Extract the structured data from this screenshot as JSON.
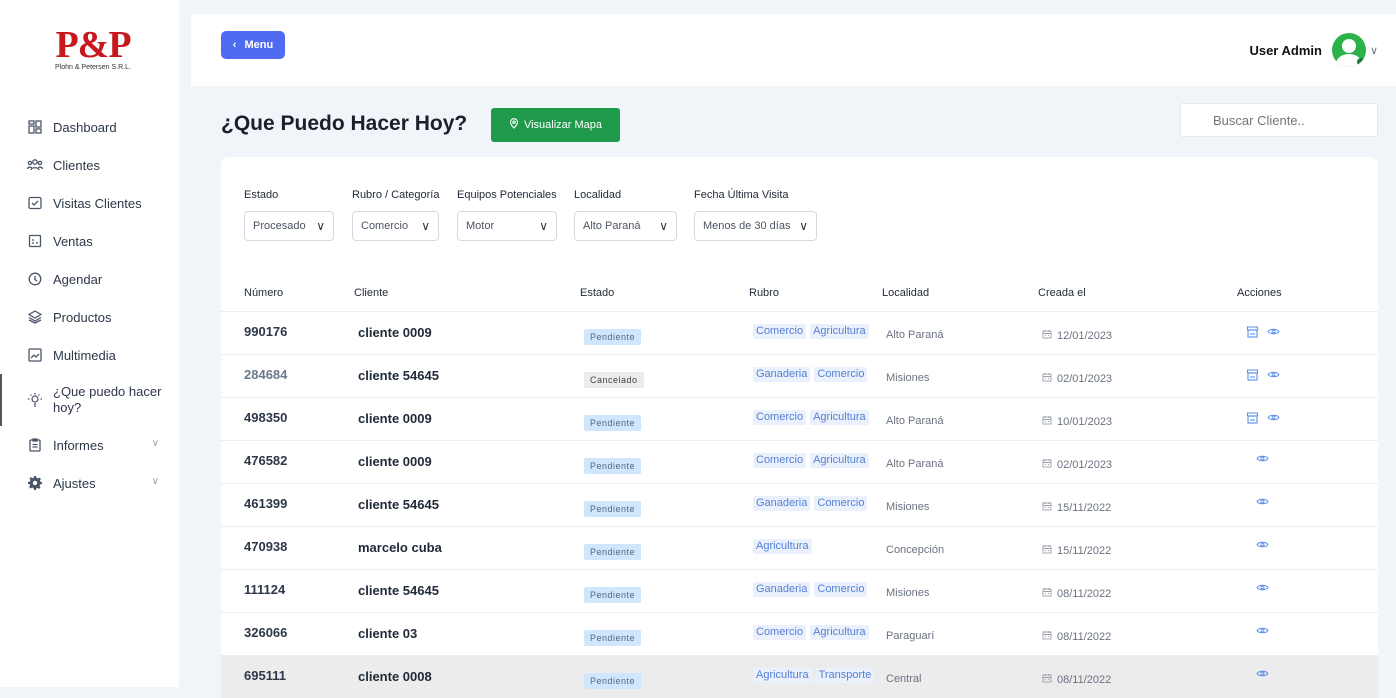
{
  "brand": {
    "logo_text": "P&P",
    "logo_sub": "Plohn & Petersen S.R.L."
  },
  "sidebar": {
    "items": [
      {
        "label": "Dashboard",
        "icon": "dashboard-icon"
      },
      {
        "label": "Clientes",
        "icon": "users-icon"
      },
      {
        "label": "Visitas Clientes",
        "icon": "checklist-icon"
      },
      {
        "label": "Ventas",
        "icon": "invoice-icon"
      },
      {
        "label": "Agendar",
        "icon": "clock-icon"
      },
      {
        "label": "Productos",
        "icon": "layers-icon"
      },
      {
        "label": "Multimedia",
        "icon": "image-icon"
      },
      {
        "label": "¿Que puedo hacer hoy?",
        "icon": "lightbulb-icon"
      },
      {
        "label": "Informes",
        "icon": "clipboard-icon"
      },
      {
        "label": "Ajustes",
        "icon": "gear-icon"
      }
    ]
  },
  "topbar": {
    "menu_label": "Menu",
    "user_name": "User Admin"
  },
  "page": {
    "title": "¿Que Puedo Hacer Hoy?",
    "map_button": "Visualizar Mapa",
    "search_placeholder": "Buscar Cliente.."
  },
  "filters": [
    {
      "label": "Estado",
      "value": "Procesado"
    },
    {
      "label": "Rubro / Categoría",
      "value": "Comercio"
    },
    {
      "label": "Equipos Potenciales",
      "value": "Motor"
    },
    {
      "label": "Localidad",
      "value": "Alto Paraná"
    },
    {
      "label": "Fecha Última Visita",
      "value": "Menos de 30 días"
    }
  ],
  "table": {
    "headers": [
      "Número",
      "Cliente",
      "Estado",
      "Rubro",
      "Localidad",
      "Creada el",
      "Acciones"
    ],
    "rows": [
      {
        "numero": "990176",
        "cliente": "cliente 0009",
        "estado": "Pendiente",
        "rubro": [
          "Comercio",
          "Agricultura"
        ],
        "localidad": "Alto Paraná",
        "fecha": "12/01/2023"
      },
      {
        "numero": "284684",
        "cliente": "cliente 54645",
        "estado": "Cancelado",
        "rubro": [
          "Ganaderia",
          "Comercio"
        ],
        "localidad": "Misiones",
        "fecha": "02/01/2023"
      },
      {
        "numero": "498350",
        "cliente": "cliente 0009",
        "estado": "Pendiente",
        "rubro": [
          "Comercio",
          "Agricultura"
        ],
        "localidad": "Alto Paraná",
        "fecha": "10/01/2023"
      },
      {
        "numero": "476582",
        "cliente": "cliente 0009",
        "estado": "Pendiente",
        "rubro": [
          "Comercio",
          "Agricultura"
        ],
        "localidad": "Alto Paraná",
        "fecha": "02/01/2023"
      },
      {
        "numero": "461399",
        "cliente": "cliente 54645",
        "estado": "Pendiente",
        "rubro": [
          "Ganaderia",
          "Comercio"
        ],
        "localidad": "Misiones",
        "fecha": "15/11/2022"
      },
      {
        "numero": "470938",
        "cliente": "marcelo cuba",
        "estado": "Pendiente",
        "rubro": [
          "Agricultura"
        ],
        "localidad": "Concepción",
        "fecha": "15/11/2022"
      },
      {
        "numero": "111124",
        "cliente": "cliente 54645",
        "estado": "Pendiente",
        "rubro": [
          "Ganaderia",
          "Comercio"
        ],
        "localidad": "Misiones",
        "fecha": "08/11/2022"
      },
      {
        "numero": "326066",
        "cliente": "cliente 03",
        "estado": "Pendiente",
        "rubro": [
          "Comercio",
          "Agricultura"
        ],
        "localidad": "Paraguarí",
        "fecha": "08/11/2022"
      },
      {
        "numero": "695111",
        "cliente": "cliente 0008",
        "estado": "Pendiente",
        "rubro": [
          "Agricultura",
          "Transporte"
        ],
        "localidad": "Central",
        "fecha": "08/11/2022"
      }
    ]
  },
  "colors": {
    "accent": "#4e6bf2",
    "map_button": "#1f9a4b",
    "brand_red": "#c8181e",
    "link_blue": "#5b8ee8"
  }
}
